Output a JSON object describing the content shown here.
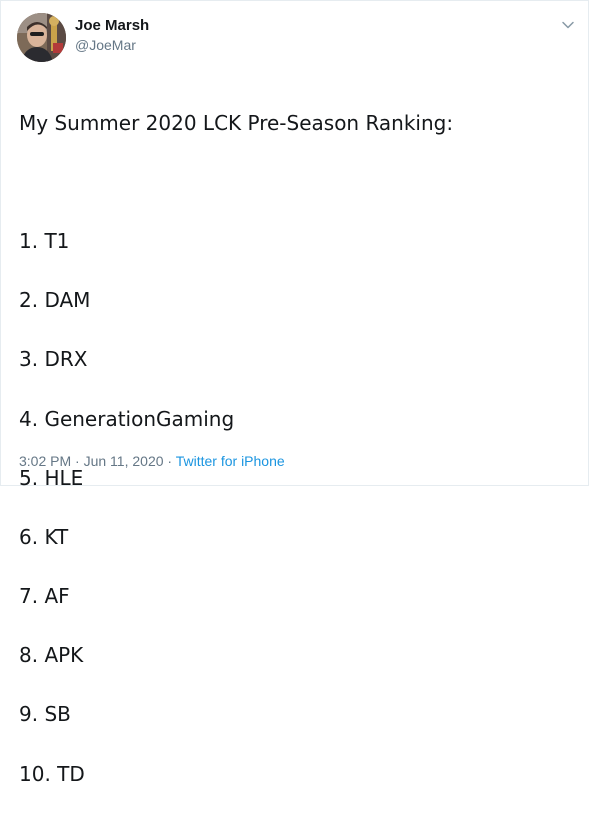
{
  "tweet": {
    "author": {
      "display_name": "Joe Marsh",
      "handle": "@JoeMar"
    },
    "menu_icon": "chevron-down-icon",
    "text": {
      "heading": "My Summer 2020 LCK Pre-Season Ranking:",
      "ranking": [
        "1. T1",
        "2. DAM",
        "3. DRX",
        "4. GenerationGaming",
        "5. HLE",
        "6. KT",
        "7. AF",
        "8. APK",
        "9. SB",
        "10. TD"
      ]
    },
    "meta": {
      "time": "3:02 PM",
      "separator": " · ",
      "date": "Jun 11, 2020",
      "source": "Twitter for iPhone"
    }
  },
  "colors": {
    "text": "#14171a",
    "secondary": "#657786",
    "link": "#1b95e0",
    "border": "#e6ecf0"
  }
}
